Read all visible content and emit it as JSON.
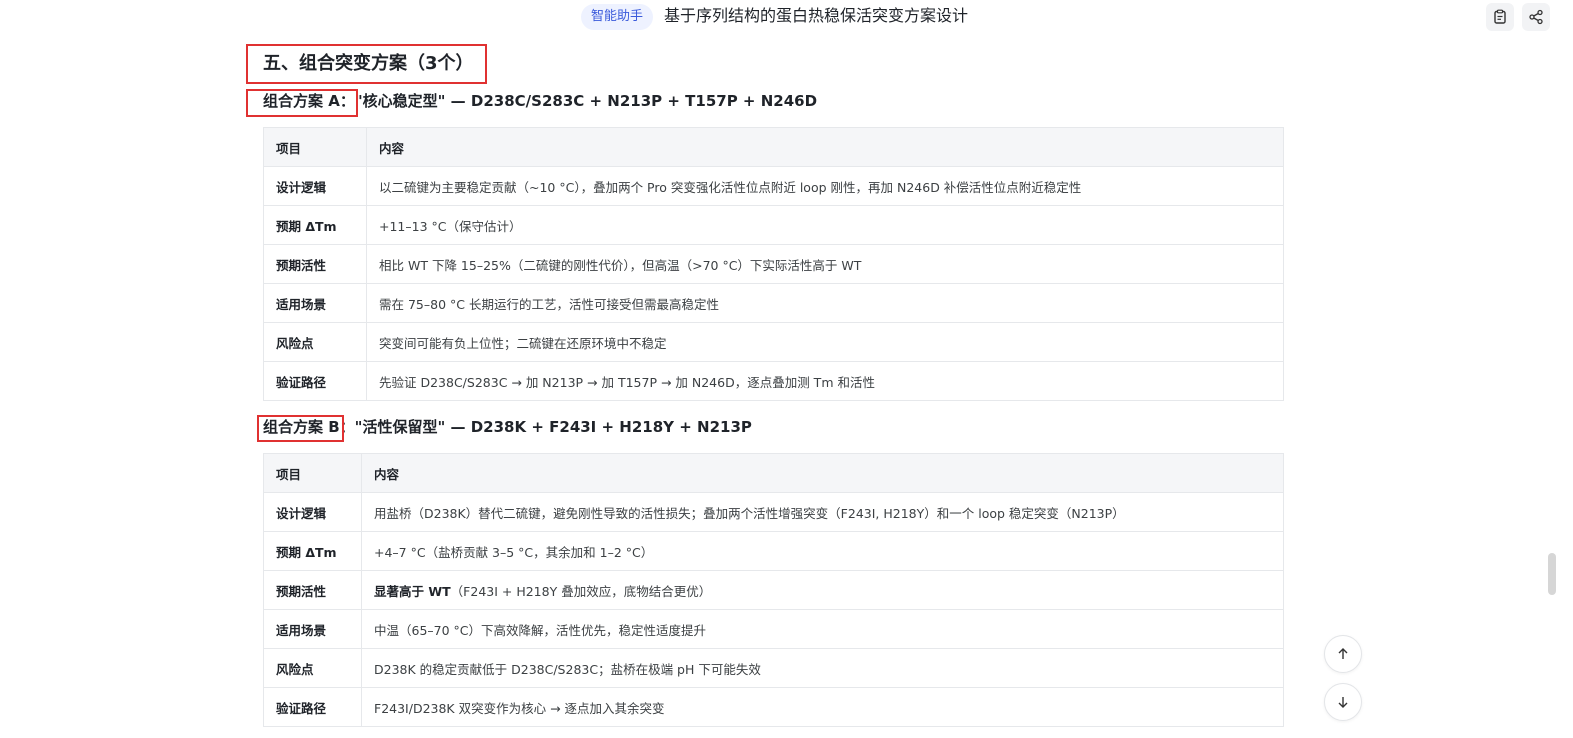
{
  "header": {
    "badge": "智能助手",
    "title": "基于序列结构的蛋白热稳保活突变方案设计",
    "icons": [
      "clipboard-icon",
      "share-icon"
    ]
  },
  "section": {
    "title": "五、组合突变方案（3个）"
  },
  "plans": [
    {
      "title": "组合方案 A：\"核心稳定型\" — D238C/S283C + N213P + T157P + N246D",
      "table": {
        "headers": [
          "项目",
          "内容"
        ],
        "rows": [
          {
            "key": "设计逻辑",
            "value": "以二硫键为主要稳定贡献（~10 °C），叠加两个 Pro 突变强化活性位点附近 loop 刚性，再加 N246D 补偿活性位点附近稳定性"
          },
          {
            "key": "预期 ΔTm",
            "value": "+11–13 °C（保守估计）"
          },
          {
            "key": "预期活性",
            "value": "相比 WT 下降 15–25%（二硫键的刚性代价），但高温（>70 °C）下实际活性高于 WT"
          },
          {
            "key": "适用场景",
            "value": "需在 75–80 °C 长期运行的工艺，活性可接受但需最高稳定性"
          },
          {
            "key": "风险点",
            "value": "突变间可能有负上位性；二硫键在还原环境中不稳定"
          },
          {
            "key": "验证路径",
            "value": "先验证 D238C/S283C → 加 N213P → 加 T157P → 加 N246D，逐点叠加测 Tm 和活性"
          }
        ]
      }
    },
    {
      "title": "组合方案 B：\"活性保留型\" — D238K + F243I + H218Y + N213P",
      "table": {
        "headers": [
          "项目",
          "内容"
        ],
        "rows": [
          {
            "key": "设计逻辑",
            "value": "用盐桥（D238K）替代二硫键，避免刚性导致的活性损失；叠加两个活性增强突变（F243I, H218Y）和一个 loop 稳定突变（N213P）"
          },
          {
            "key": "预期 ΔTm",
            "value": "+4–7 °C（盐桥贡献 3–5 °C，其余加和 1–2 °C）"
          },
          {
            "key": "预期活性",
            "strong": "显著高于 WT",
            "value": "（F243I + H218Y 叠加效应，底物结合更优）"
          },
          {
            "key": "适用场景",
            "value": "中温（65–70 °C）下高效降解，活性优先，稳定性适度提升"
          },
          {
            "key": "风险点",
            "value": "D238K 的稳定贡献低于 D238C/S283C；盐桥在极端 pH 下可能失效"
          },
          {
            "key": "验证路径",
            "value": "F243I/D238K 双突变作为核心 → 逐点加入其余突变"
          }
        ]
      }
    }
  ],
  "float_buttons": [
    "arrow-up-icon",
    "arrow-down-icon"
  ]
}
